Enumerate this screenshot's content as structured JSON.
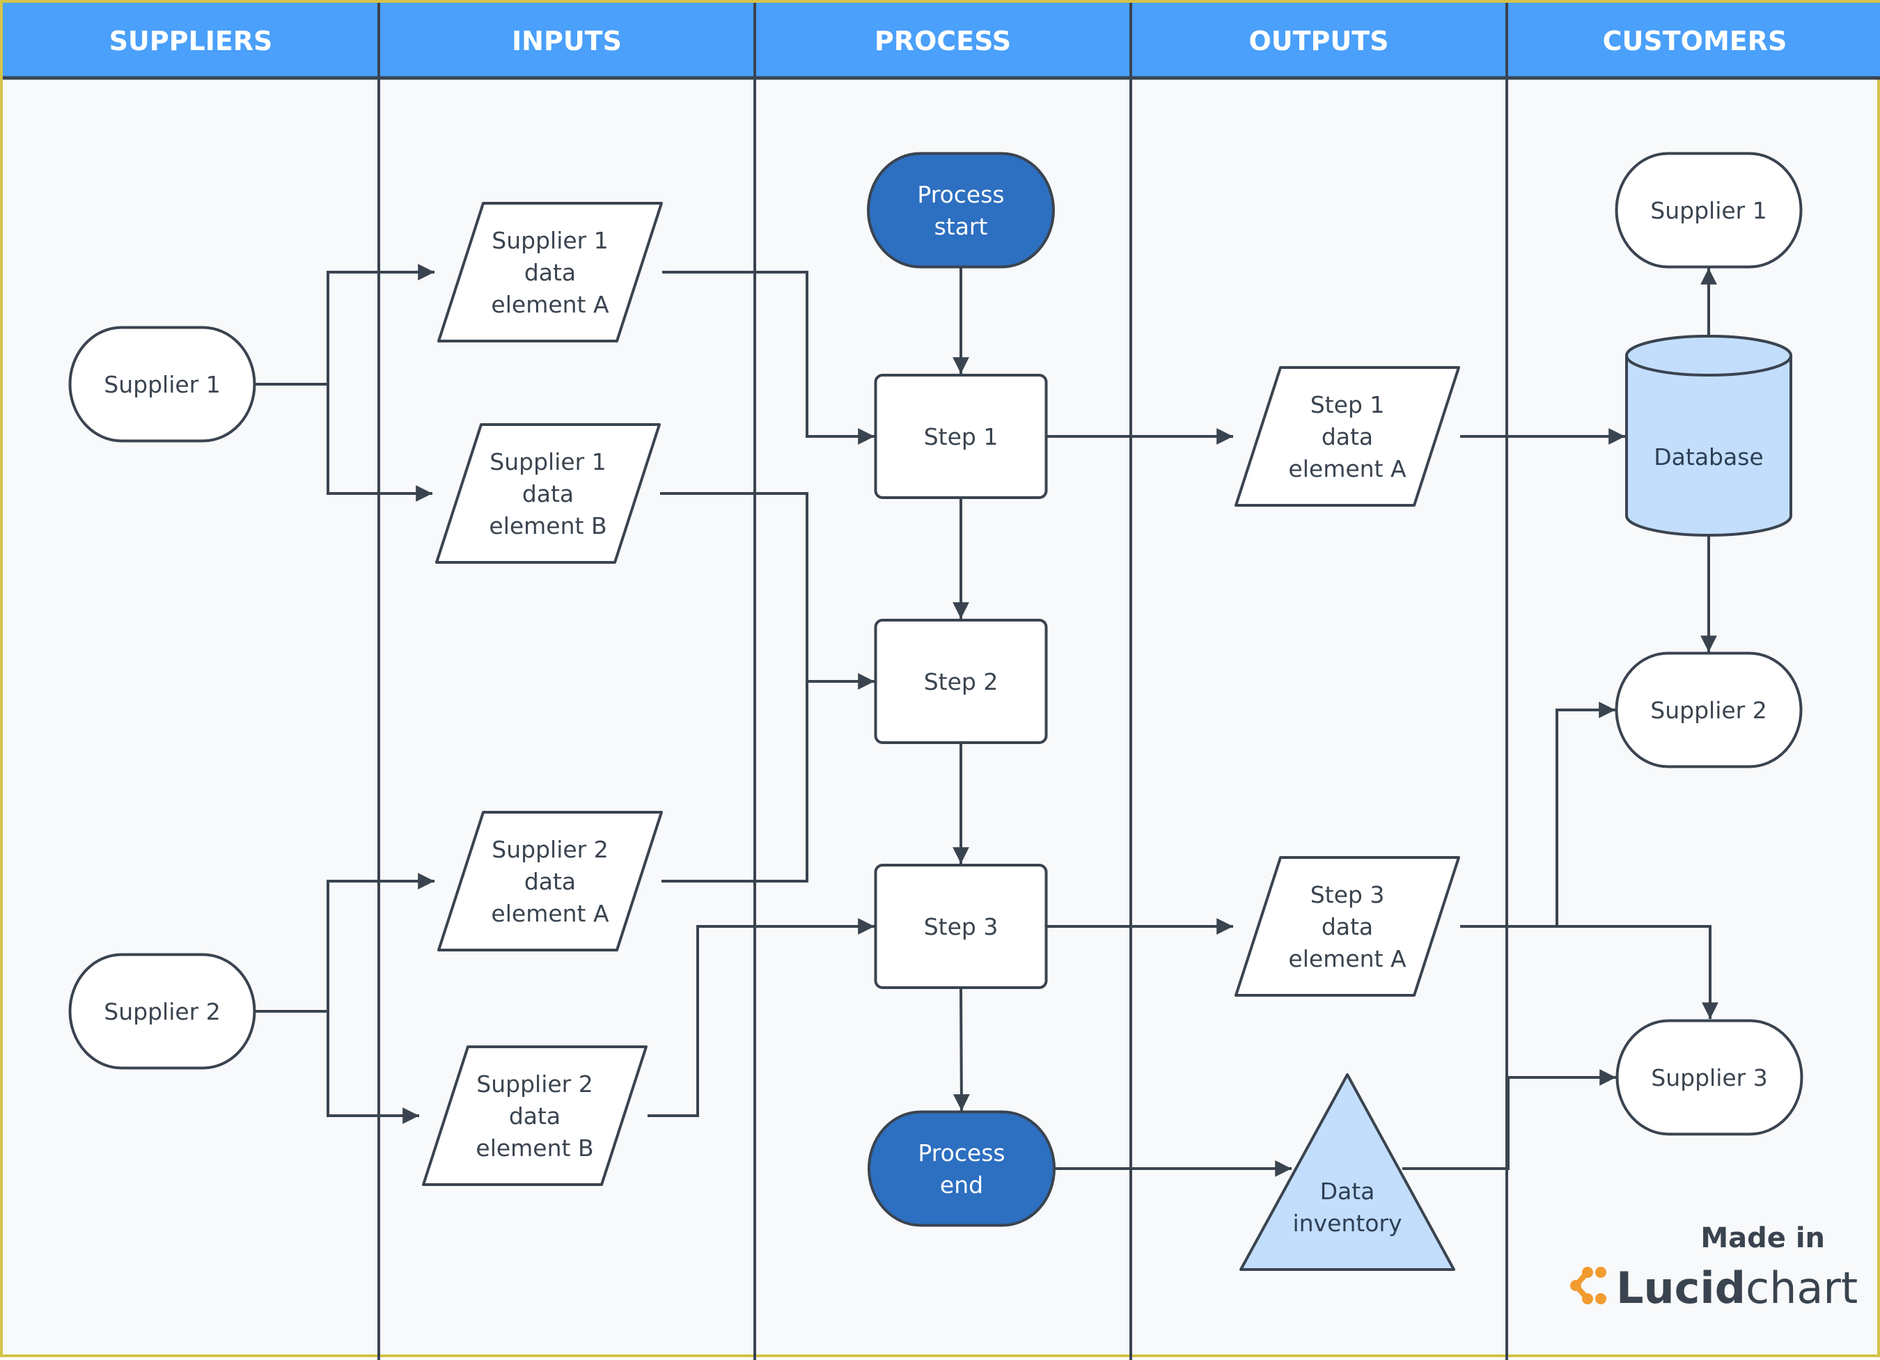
{
  "diagram": {
    "type": "SIPOC swimlane flowchart",
    "lanes": [
      {
        "id": "suppliers",
        "title": "SUPPLIERS"
      },
      {
        "id": "inputs",
        "title": "INPUTS"
      },
      {
        "id": "process",
        "title": "PROCESS"
      },
      {
        "id": "outputs",
        "title": "OUTPUTS"
      },
      {
        "id": "customers",
        "title": "CUSTOMERS"
      }
    ],
    "nodes": {
      "sup1": {
        "shape": "terminator",
        "lines": [
          "Supplier 1"
        ]
      },
      "sup2": {
        "shape": "terminator",
        "lines": [
          "Supplier 2"
        ]
      },
      "in1a": {
        "shape": "data",
        "lines": [
          "Supplier 1",
          "data",
          "element A"
        ]
      },
      "in1b": {
        "shape": "data",
        "lines": [
          "Supplier 1",
          "data",
          "element B"
        ]
      },
      "in2a": {
        "shape": "data",
        "lines": [
          "Supplier 2",
          "data",
          "element A"
        ]
      },
      "in2b": {
        "shape": "data",
        "lines": [
          "Supplier 2",
          "data",
          "element B"
        ]
      },
      "pstart": {
        "shape": "terminator",
        "lines": [
          "Process",
          "start"
        ]
      },
      "step1": {
        "shape": "process",
        "lines": [
          "Step 1"
        ]
      },
      "step2": {
        "shape": "process",
        "lines": [
          "Step 2"
        ]
      },
      "step3": {
        "shape": "process",
        "lines": [
          "Step 3"
        ]
      },
      "pend": {
        "shape": "terminator",
        "lines": [
          "Process",
          "end"
        ]
      },
      "out1": {
        "shape": "data",
        "lines": [
          "Step 1",
          "data",
          "element A"
        ]
      },
      "out3": {
        "shape": "data",
        "lines": [
          "Step 3",
          "data",
          "element A"
        ]
      },
      "inventory": {
        "shape": "triangle",
        "lines": [
          "Data",
          "inventory"
        ]
      },
      "database": {
        "shape": "cylinder",
        "lines": [
          "Database"
        ]
      },
      "cust1": {
        "shape": "terminator",
        "lines": [
          "Supplier 1"
        ]
      },
      "cust2": {
        "shape": "terminator",
        "lines": [
          "Supplier 2"
        ]
      },
      "cust3": {
        "shape": "terminator",
        "lines": [
          "Supplier 3"
        ]
      }
    },
    "edges": [
      {
        "from": "sup1",
        "to": "in1a"
      },
      {
        "from": "sup1",
        "to": "in1b"
      },
      {
        "from": "sup2",
        "to": "in2a"
      },
      {
        "from": "sup2",
        "to": "in2b"
      },
      {
        "from": "in1a",
        "to": "step1"
      },
      {
        "from": "in1b",
        "to": "step2"
      },
      {
        "from": "in2a",
        "to": "step2"
      },
      {
        "from": "in2b",
        "to": "step3"
      },
      {
        "from": "pstart",
        "to": "step1"
      },
      {
        "from": "step1",
        "to": "step2"
      },
      {
        "from": "step2",
        "to": "step3"
      },
      {
        "from": "step3",
        "to": "pend"
      },
      {
        "from": "step1",
        "to": "out1"
      },
      {
        "from": "step3",
        "to": "out3"
      },
      {
        "from": "pend",
        "to": "inventory"
      },
      {
        "from": "out1",
        "to": "database"
      },
      {
        "from": "database",
        "to": "cust1"
      },
      {
        "from": "database",
        "to": "cust2"
      },
      {
        "from": "out3",
        "to": "cust2"
      },
      {
        "from": "out3",
        "to": "cust3"
      },
      {
        "from": "inventory",
        "to": "cust3"
      }
    ]
  },
  "colors": {
    "header": "#4aa0fa",
    "terminal_dark": "#2d6fc0",
    "light_fill": "#c2defc",
    "stroke": "#3a4450",
    "background": "#f8f9fa",
    "brand_orange": "#f29b2e"
  },
  "branding": {
    "made_in": "Made in",
    "logo_bold": "Lucid",
    "logo_light": "chart"
  }
}
